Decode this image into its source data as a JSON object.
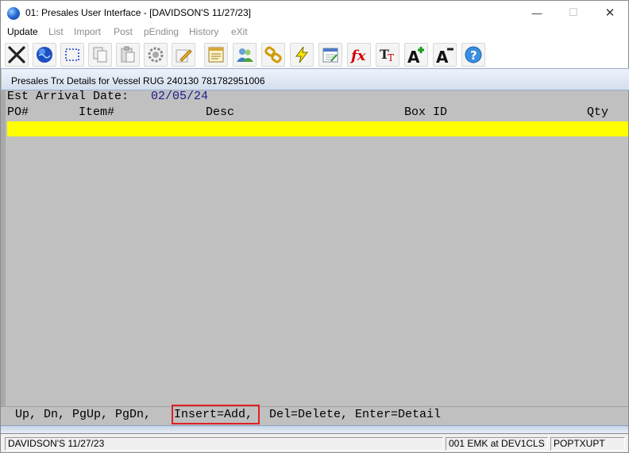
{
  "window": {
    "title": "01: Presales User Interface - [DAVIDSON'S 11/27/23]",
    "minimize_glyph": "—",
    "maximize_glyph": "☐",
    "close_glyph": "✕"
  },
  "menu": {
    "items": [
      {
        "label": "Update",
        "enabled": true
      },
      {
        "label": "List",
        "enabled": false
      },
      {
        "label": "Import",
        "enabled": false
      },
      {
        "label": "Post",
        "enabled": false
      },
      {
        "label": "pEnding",
        "enabled": false
      },
      {
        "label": "History",
        "enabled": false
      },
      {
        "label": "eXit",
        "enabled": false
      }
    ]
  },
  "toolbar": {
    "icons": [
      "close-x-icon",
      "globe-icon",
      "select-rect-icon",
      "copy-icon",
      "paste-icon",
      "settings-icon",
      "edit-pencil-icon",
      "notepad-icon",
      "users-icon",
      "link-chain-icon",
      "lightning-icon",
      "calendar-icon",
      "function-fx-icon",
      "font-tt-icon",
      "font-increase-icon",
      "font-decrease-icon",
      "help-icon"
    ]
  },
  "panel": {
    "title": "Presales Trx Details for Vessel  RUG 240130 781782951006",
    "arrival_label": "Est Arrival Date:",
    "arrival_value": "02/05/24",
    "columns": {
      "po": "PO#",
      "item": "Item#",
      "desc": "Desc",
      "box_id": "Box ID",
      "qty": "Qty"
    },
    "hint_before": "Up, Dn, PgUp, PgDn,",
    "hint_highlight": "Insert=Add,",
    "hint_after": "Del=Delete, Enter=Detail"
  },
  "statusbar": {
    "company": "DAVIDSON'S 11/27/23",
    "session": "001 EMK at DEV1CLS",
    "program": "POPTXUPT"
  },
  "colors": {
    "selected_row": "#ffff00",
    "date_value": "#1a1a8c",
    "highlight_box": "#e02020",
    "panel_background": "#c0c0c0"
  }
}
